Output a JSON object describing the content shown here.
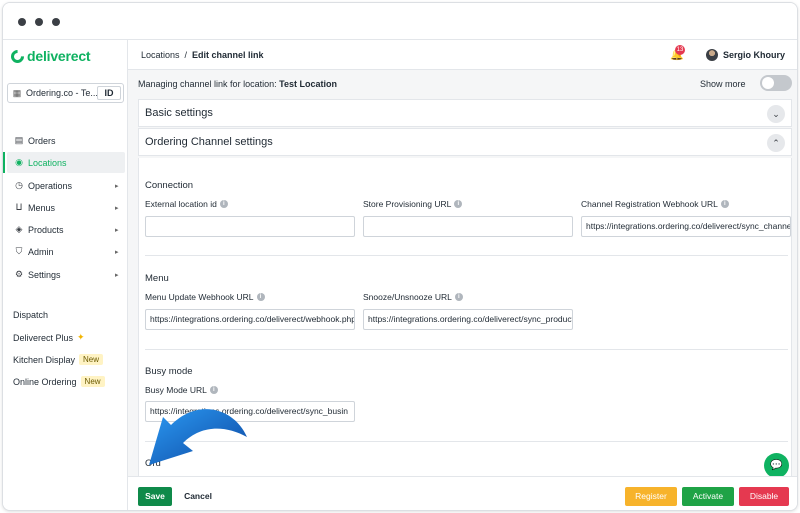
{
  "brand": {
    "name": "deliverect",
    "color": "#0fb261"
  },
  "location_select": {
    "name": "Ordering.co - Te...",
    "id_label": "ID"
  },
  "sidebar": {
    "items": [
      {
        "label": "Orders",
        "icon": "orders-icon",
        "glyph": "▤",
        "has_chevron": false,
        "active": false
      },
      {
        "label": "Locations",
        "icon": "location-pin-icon",
        "glyph": "◉",
        "has_chevron": false,
        "active": true
      },
      {
        "label": "Operations",
        "icon": "clock-icon",
        "glyph": "◷",
        "has_chevron": true,
        "active": false
      },
      {
        "label": "Menus",
        "icon": "cutlery-icon",
        "glyph": "🍴",
        "has_chevron": true,
        "active": false
      },
      {
        "label": "Products",
        "icon": "tag-icon",
        "glyph": "◈",
        "has_chevron": true,
        "active": false
      },
      {
        "label": "Admin",
        "icon": "shield-icon",
        "glyph": "⛉",
        "has_chevron": true,
        "active": false
      },
      {
        "label": "Settings",
        "icon": "gear-icon",
        "glyph": "⚙",
        "has_chevron": true,
        "active": false
      }
    ],
    "extras": {
      "dispatch": "Dispatch",
      "deliverect_plus": "Deliverect Plus",
      "kitchen_display": "Kitchen Display",
      "online_ordering": "Online Ordering",
      "new_badge": "New"
    }
  },
  "header": {
    "breadcrumb_root": "Locations",
    "breadcrumb_sep": "/",
    "breadcrumb_current": "Edit channel link",
    "notification_count": "13",
    "user_name": "Sergio Khoury"
  },
  "page": {
    "managing_prefix": "Managing channel link for location:",
    "managing_location": "Test Location",
    "show_more": "Show more",
    "show_more_enabled": false
  },
  "panels": {
    "basic": "Basic settings",
    "ordering": "Ordering Channel settings"
  },
  "connection": {
    "title": "Connection",
    "external_location_label": "External location id",
    "external_location_value": "",
    "store_provisioning_label": "Store Provisioning URL",
    "store_provisioning_value": "",
    "channel_registration_label": "Channel Registration Webhook URL",
    "channel_registration_value": "https://integrations.ordering.co/deliverect/sync_channel"
  },
  "menu": {
    "title": "Menu",
    "menu_update_label": "Menu Update Webhook URL",
    "menu_update_value": "https://integrations.ordering.co/deliverect/webhook.php",
    "snooze_label": "Snooze/Unsnooze URL",
    "snooze_value": "https://integrations.ordering.co/deliverect/sync_products"
  },
  "busy": {
    "title": "Busy mode",
    "busy_url_label": "Busy Mode URL",
    "busy_url_value": "https://integrations.ordering.co/deliverect/sync_busin"
  },
  "next_section_partial": "Ord",
  "footer": {
    "save": "Save",
    "cancel": "Cancel",
    "register": "Register",
    "activate": "Activate",
    "disable": "Disable"
  },
  "colors": {
    "accent": "#0fb261",
    "save": "#0f8a4a",
    "register": "#f7b32b",
    "activate": "#1fa346",
    "disable": "#e53950",
    "overlay_arrow": "#1e88e5"
  }
}
